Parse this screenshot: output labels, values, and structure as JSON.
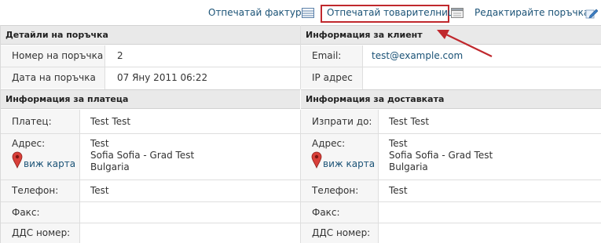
{
  "toolbar": {
    "print_invoice": "Отпечатай фактура",
    "print_packing": "Отпечатай товарителница",
    "edit_order": "Редактирайте поръчка"
  },
  "order": {
    "title": "Детайли на поръчка",
    "number_label": "Номер на поръчка",
    "number_value": "2",
    "date_label": "Дата на поръчка",
    "date_value": "07 Яну 2011 06:22"
  },
  "customer": {
    "title": "Информация за клиент",
    "email_label": "Email:",
    "email_value": "test@example.com",
    "ip_label": "IP адрес",
    "ip_value": ""
  },
  "billing": {
    "title": "Информация за платеца",
    "payer_label": "Платец:",
    "payer_value": "Test Test",
    "address_label": "Адрес:",
    "address_line1": "Test",
    "address_line2": "Sofia Sofia - Grad Test",
    "address_line3": "Bulgaria",
    "map_link": "виж карта",
    "phone_label": "Телефон:",
    "phone_value": "Test",
    "fax_label": "Факс:",
    "fax_value": "",
    "vat_label": "ДДС номер:",
    "vat_value": ""
  },
  "shipping": {
    "title": "Информация за доставката",
    "ship_to_label": "Изпрати до:",
    "ship_to_value": "Test Test",
    "address_label": "Адрес:",
    "address_line1": "Test",
    "address_line2": "Sofia Sofia - Grad Test",
    "address_line3": "Bulgaria",
    "map_link": "виж карта",
    "phone_label": "Телефон:",
    "phone_value": "Test",
    "fax_label": "Факс:",
    "fax_value": "",
    "vat_label": "ДДС номер:",
    "vat_value": ""
  },
  "colors": {
    "link": "#1a5276",
    "highlight": "#c0282d",
    "header_bg": "#e9e9e9",
    "label_bg": "#f6f6f6"
  },
  "icons": [
    "invoice-icon",
    "packing-slip-icon",
    "edit-icon",
    "map-pin-icon",
    "annotation-arrow"
  ]
}
